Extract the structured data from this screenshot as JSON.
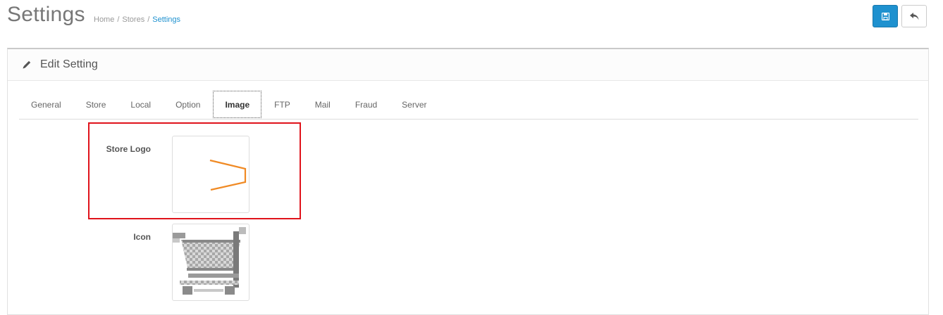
{
  "header": {
    "title": "Settings",
    "breadcrumb": [
      "Home",
      "Stores",
      "Settings"
    ],
    "save_icon": "save-icon",
    "back_icon": "reply-icon"
  },
  "panel": {
    "icon": "pencil-icon",
    "title": "Edit Setting"
  },
  "tabs": [
    {
      "label": "General",
      "active": false
    },
    {
      "label": "Store",
      "active": false
    },
    {
      "label": "Local",
      "active": false
    },
    {
      "label": "Option",
      "active": false
    },
    {
      "label": "Image",
      "active": true
    },
    {
      "label": "FTP",
      "active": false
    },
    {
      "label": "Mail",
      "active": false
    },
    {
      "label": "Fraud",
      "active": false
    },
    {
      "label": "Server",
      "active": false
    }
  ],
  "image_tab": {
    "store_logo_label": "Store Logo",
    "icon_label": "Icon"
  },
  "colors": {
    "primary": "#1e91cf",
    "highlight": "#e0131b",
    "logo_accent": "#f08a24"
  }
}
